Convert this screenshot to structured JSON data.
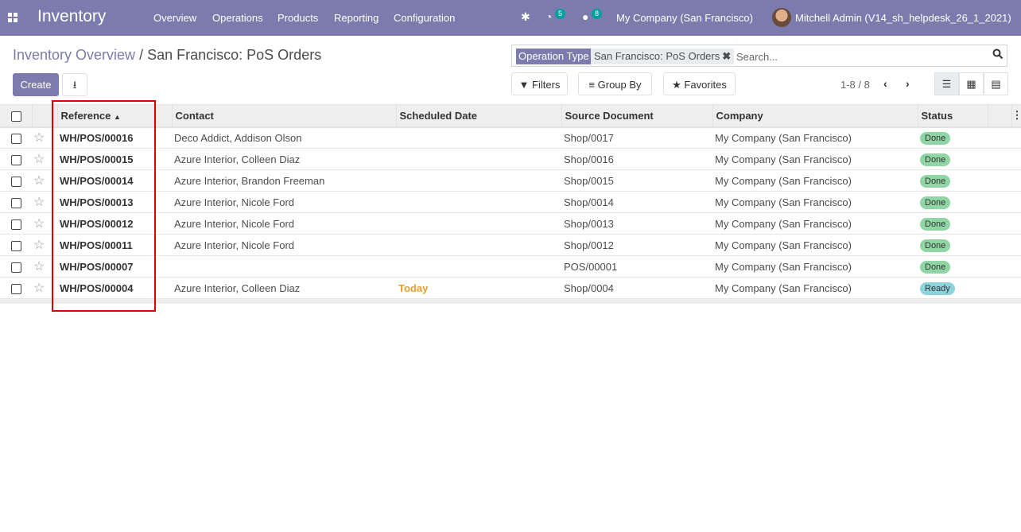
{
  "navbar": {
    "app_title": "Inventory",
    "menu": [
      "Overview",
      "Operations",
      "Products",
      "Reporting",
      "Configuration"
    ],
    "activity_count": "5",
    "message_count": "8",
    "company": "My Company (San Francisco)",
    "user": "Mitchell Admin (V14_sh_helpdesk_26_1_2021)"
  },
  "breadcrumb": {
    "parent": "Inventory Overview",
    "separator": "/",
    "current": "San Francisco: PoS Orders"
  },
  "toolbar": {
    "create_label": "Create",
    "filters_label": "Filters",
    "groupby_label": "Group By",
    "favorites_label": "Favorites"
  },
  "search": {
    "facet_label": "Operation Type",
    "facet_value": "San Francisco: PoS Orders",
    "placeholder": "Search..."
  },
  "pager": {
    "text": "1-8 / 8"
  },
  "table": {
    "headers": {
      "reference": "Reference",
      "contact": "Contact",
      "scheduled_date": "Scheduled Date",
      "source_document": "Source Document",
      "company": "Company",
      "status": "Status"
    },
    "rows": [
      {
        "reference": "WH/POS/00016",
        "contact": "Deco Addict, Addison Olson",
        "scheduled": "",
        "source": "Shop/0017",
        "company": "My Company (San Francisco)",
        "status": "Done"
      },
      {
        "reference": "WH/POS/00015",
        "contact": "Azure Interior, Colleen Diaz",
        "scheduled": "",
        "source": "Shop/0016",
        "company": "My Company (San Francisco)",
        "status": "Done"
      },
      {
        "reference": "WH/POS/00014",
        "contact": "Azure Interior, Brandon Freeman",
        "scheduled": "",
        "source": "Shop/0015",
        "company": "My Company (San Francisco)",
        "status": "Done"
      },
      {
        "reference": "WH/POS/00013",
        "contact": "Azure Interior, Nicole Ford",
        "scheduled": "",
        "source": "Shop/0014",
        "company": "My Company (San Francisco)",
        "status": "Done"
      },
      {
        "reference": "WH/POS/00012",
        "contact": "Azure Interior, Nicole Ford",
        "scheduled": "",
        "source": "Shop/0013",
        "company": "My Company (San Francisco)",
        "status": "Done"
      },
      {
        "reference": "WH/POS/00011",
        "contact": "Azure Interior, Nicole Ford",
        "scheduled": "",
        "source": "Shop/0012",
        "company": "My Company (San Francisco)",
        "status": "Done"
      },
      {
        "reference": "WH/POS/00007",
        "contact": "",
        "scheduled": "",
        "source": "POS/00001",
        "company": "My Company (San Francisco)",
        "status": "Done"
      },
      {
        "reference": "WH/POS/00004",
        "contact": "Azure Interior, Colleen Diaz",
        "scheduled": "Today",
        "source": "Shop/0004",
        "company": "My Company (San Francisco)",
        "status": "Ready"
      }
    ]
  },
  "colors": {
    "brand": "#7c7bad",
    "done": "#8fd6a4",
    "ready": "#8cd3dc",
    "today": "#e0a22a",
    "highlight": "#dd0000"
  }
}
